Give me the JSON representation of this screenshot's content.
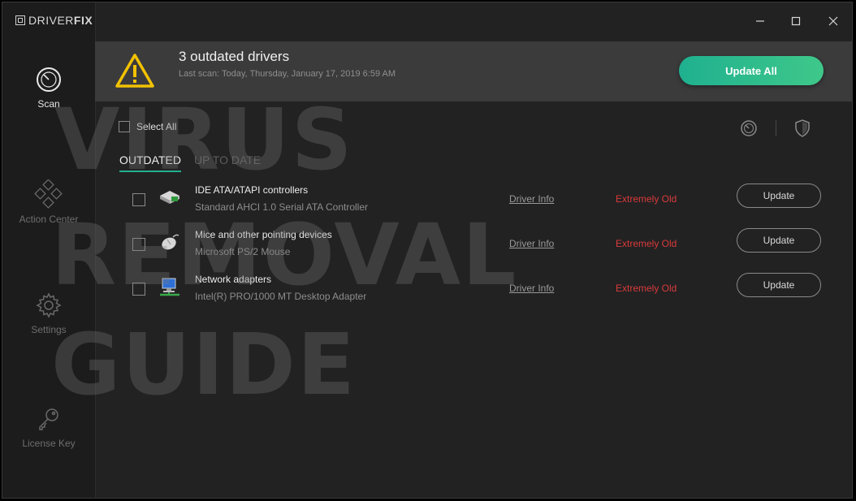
{
  "app": {
    "brand_thin": "DRIVER",
    "brand_bold": "FIX"
  },
  "sidebar": {
    "items": [
      {
        "label": "Scan",
        "icon": "scan-gauge-icon",
        "active": true
      },
      {
        "label": "Action Center",
        "icon": "action-center-diamond-icon",
        "active": false
      },
      {
        "label": "Settings",
        "icon": "gear-icon",
        "active": false
      },
      {
        "label": "License Key",
        "icon": "key-icon",
        "active": false
      }
    ]
  },
  "banner": {
    "title": "3 outdated drivers",
    "subtitle": "Last scan: Today, Thursday, January 17, 2019 6:59 AM",
    "update_all_label": "Update All",
    "warning_icon": "warning-triangle-icon",
    "accent_color": "#2db88d"
  },
  "window_controls": {
    "minimize": "minimize-icon",
    "maximize": "maximize-icon",
    "close": "close-icon"
  },
  "toolbar": {
    "select_all_label": "Select All",
    "icons": [
      "speed-gauge-icon",
      "shield-icon"
    ]
  },
  "tabs": [
    {
      "label": "OUTDATED",
      "active": true
    },
    {
      "label": "UP TO DATE",
      "active": false
    }
  ],
  "drivers": [
    {
      "category": "IDE ATA/ATAPI controllers",
      "device": "Standard AHCI 1.0 Serial ATA Controller",
      "info_label": "Driver Info",
      "status": "Extremely Old",
      "button_label": "Update",
      "icon": "disk-controller-icon"
    },
    {
      "category": "Mice and other pointing devices",
      "device": "Microsoft PS/2 Mouse",
      "info_label": "Driver Info",
      "status": "Extremely Old",
      "button_label": "Update",
      "icon": "mouse-icon"
    },
    {
      "category": "Network adapters",
      "device": "Intel(R) PRO/1000 MT Desktop Adapter",
      "info_label": "Driver Info",
      "status": "Extremely Old",
      "button_label": "Update",
      "icon": "network-adapter-icon"
    }
  ],
  "colors": {
    "status_red": "#d93a3a",
    "tab_underline": "#22b08e"
  },
  "watermark": {
    "line1": "VIRUS",
    "line2": "REMOVAL",
    "line3": "GUIDE"
  }
}
